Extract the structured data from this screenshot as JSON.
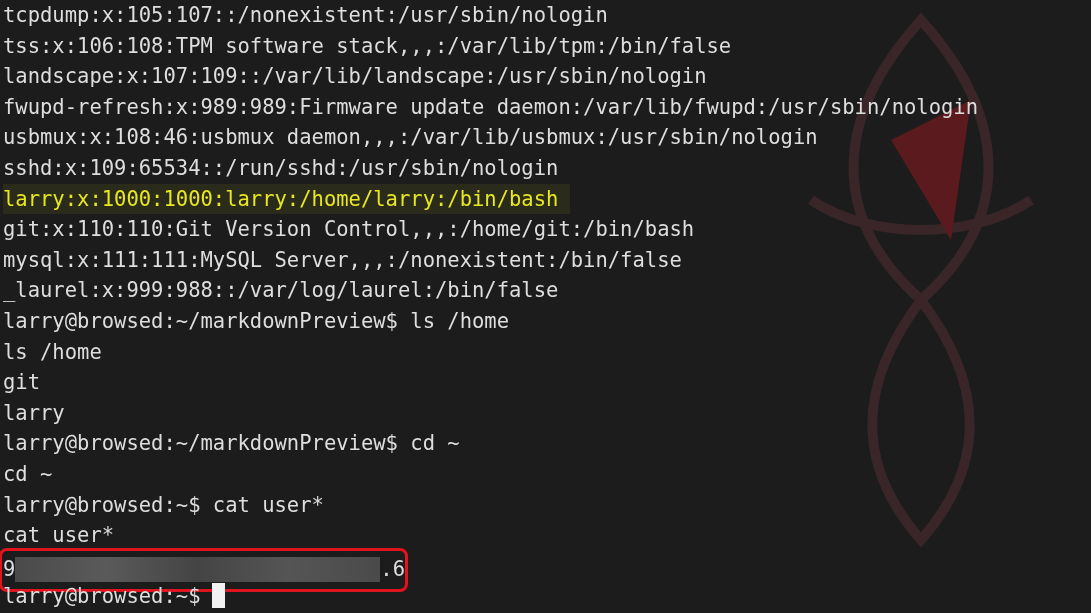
{
  "terminal": {
    "lines": [
      {
        "kind": "plain",
        "text": "tcpdump:x:105:107::/nonexistent:/usr/sbin/nologin"
      },
      {
        "kind": "plain",
        "text": "tss:x:106:108:TPM software stack,,,:/var/lib/tpm:/bin/false"
      },
      {
        "kind": "plain",
        "text": "landscape:x:107:109::/var/lib/landscape:/usr/sbin/nologin"
      },
      {
        "kind": "plain",
        "text": "fwupd-refresh:x:989:989:Firmware update daemon:/var/lib/fwupd:/usr/sbin/nologin"
      },
      {
        "kind": "plain",
        "text": "usbmux:x:108:46:usbmux daemon,,,:/var/lib/usbmux:/usr/sbin/nologin"
      },
      {
        "kind": "plain",
        "text": "sshd:x:109:65534::/run/sshd:/usr/sbin/nologin"
      },
      {
        "kind": "highlighted",
        "text": "larry:x:1000:1000:larry:/home/larry:/bin/bash"
      },
      {
        "kind": "plain",
        "text": "git:x:110:110:Git Version Control,,,:/home/git:/bin/bash"
      },
      {
        "kind": "plain",
        "text": "mysql:x:111:111:MySQL Server,,,:/nonexistent:/bin/false"
      },
      {
        "kind": "plain",
        "text": "_laurel:x:999:988::/var/log/laurel:/bin/false"
      },
      {
        "kind": "plain",
        "text": "larry@browsed:~/markdownPreview$ ls /home"
      },
      {
        "kind": "plain",
        "text": "ls /home"
      },
      {
        "kind": "plain",
        "text": "git"
      },
      {
        "kind": "plain",
        "text": "larry"
      },
      {
        "kind": "plain",
        "text": "larry@browsed:~/markdownPreview$ cd ~"
      },
      {
        "kind": "plain",
        "text": "cd ~"
      },
      {
        "kind": "plain",
        "text": "larry@browsed:~$ cat user*"
      },
      {
        "kind": "plain",
        "text": "cat user*"
      },
      {
        "kind": "redacted",
        "before": "9",
        "after": ".6"
      },
      {
        "kind": "prompt",
        "text": "larry@browsed:~$",
        "cursor": true
      }
    ]
  }
}
